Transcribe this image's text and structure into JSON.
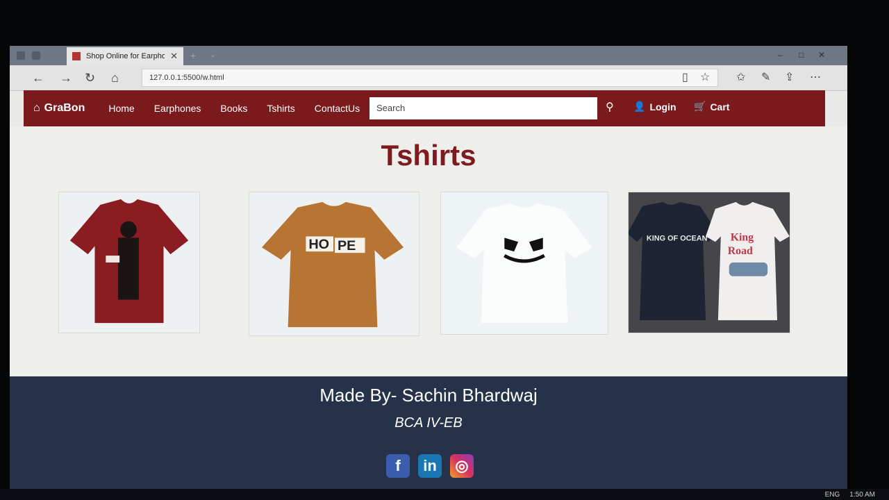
{
  "browser": {
    "tab_title": "Shop Online for Earpho",
    "tab_close": "✕",
    "url": "127.0.0.1:5500/w.html"
  },
  "site": {
    "brand": "GraBon",
    "nav": [
      "Home",
      "Earphones",
      "Books",
      "Tshirts",
      "ContactUs"
    ],
    "search_placeholder": "Search",
    "login": "Login",
    "cart": "Cart"
  },
  "page": {
    "title": "Tshirts",
    "products": [
      {
        "name": "red-tshirt",
        "color": "#8a1c22"
      },
      {
        "name": "hope-tshirt",
        "color": "#b87433",
        "print": "HOPE"
      },
      {
        "name": "marshmello-tshirt",
        "color": "#f7f8f8"
      },
      {
        "name": "king-road-tshirts",
        "color": "#1e2433",
        "print1": "KING OF OCEAN",
        "print2": "King Road"
      }
    ]
  },
  "footer": {
    "made_by": "Made By- Sachin Bhardwaj",
    "course": "BCA IV-EB",
    "social": {
      "facebook": "f",
      "linkedin": "in",
      "instagram": "◎"
    }
  },
  "taskbar": {
    "lang": "ENG",
    "time": "1:50 AM"
  }
}
